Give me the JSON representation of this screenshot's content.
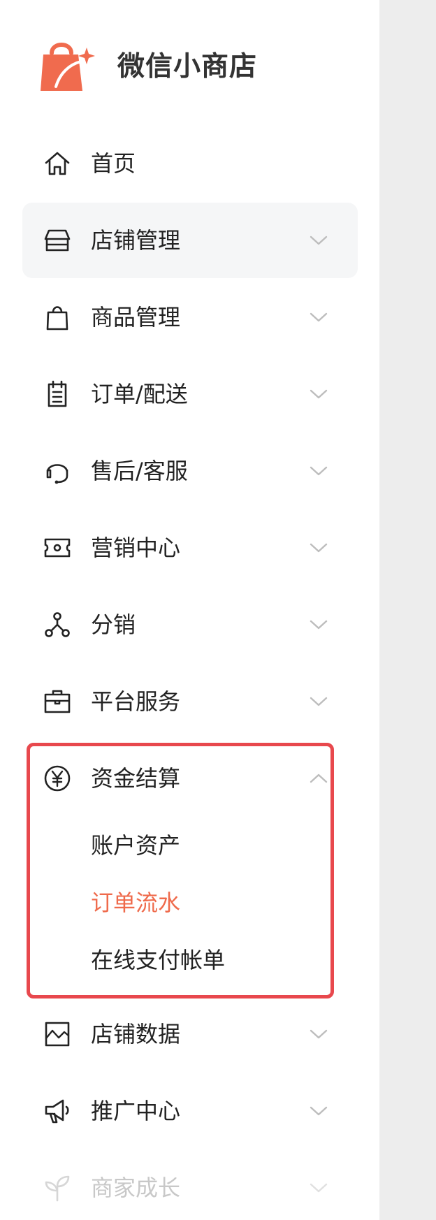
{
  "brand": {
    "title": "微信小商店",
    "logo_icon": "shopping-bag-sparkle-icon",
    "accent_color": "#f06b4e"
  },
  "menu": {
    "items": [
      {
        "label": "首页",
        "icon": "home-icon",
        "expandable": false
      },
      {
        "label": "店铺管理",
        "icon": "store-icon",
        "expandable": true,
        "state": "collapsed",
        "active": true
      },
      {
        "label": "商品管理",
        "icon": "bag-icon",
        "expandable": true,
        "state": "collapsed"
      },
      {
        "label": "订单/配送",
        "icon": "clipboard-icon",
        "expandable": true,
        "state": "collapsed"
      },
      {
        "label": "售后/客服",
        "icon": "headset-icon",
        "expandable": true,
        "state": "collapsed"
      },
      {
        "label": "营销中心",
        "icon": "ticket-icon",
        "expandable": true,
        "state": "collapsed"
      },
      {
        "label": "分销",
        "icon": "distribution-icon",
        "expandable": true,
        "state": "collapsed"
      },
      {
        "label": "平台服务",
        "icon": "briefcase-icon",
        "expandable": true,
        "state": "collapsed"
      },
      {
        "label": "资金结算",
        "icon": "yen-icon",
        "expandable": true,
        "state": "expanded"
      },
      {
        "label": "店铺数据",
        "icon": "chart-icon",
        "expandable": true,
        "state": "collapsed"
      },
      {
        "label": "推广中心",
        "icon": "megaphone-icon",
        "expandable": true,
        "state": "collapsed"
      },
      {
        "label": "商家成长",
        "icon": "sprout-icon",
        "expandable": true,
        "state": "collapsed",
        "faded": true
      }
    ],
    "settlement_subitems": [
      {
        "label": "账户资产",
        "selected": false
      },
      {
        "label": "订单流水",
        "selected": true
      },
      {
        "label": "在线支付帐单",
        "selected": false
      }
    ]
  },
  "colors": {
    "selected_text": "#ef6a4b",
    "highlight_border": "#e8484d",
    "active_row_bg": "#f5f6f7"
  }
}
